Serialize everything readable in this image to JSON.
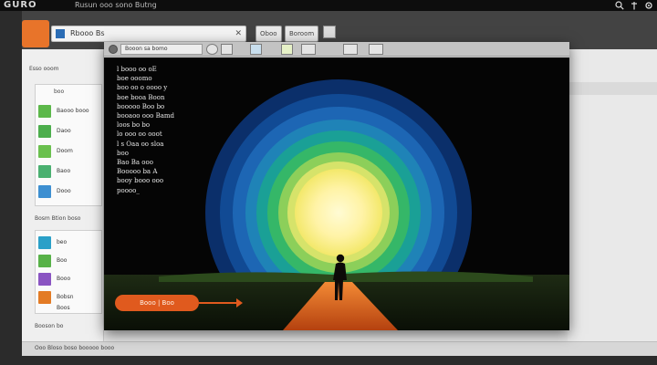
{
  "topbar": {
    "logo": "GURO",
    "title": "Rusun ooo sono Butng",
    "icons": [
      "search-icon",
      "pin-icon",
      "settings-icon"
    ]
  },
  "app": {
    "address_text": "Rbooo Bs",
    "toolbar_buttons": [
      "Oboo",
      "Boroom"
    ],
    "sidebar": {
      "header_top": "Esso ooom",
      "group1_title": "boo",
      "group1_items": [
        "Baooo booo",
        "Daoo",
        "Doom",
        "Baoo",
        "Dooo"
      ],
      "group1_colors": [
        "#5cb84a",
        "#4cae4c",
        "#6ac04e",
        "#4ab070",
        "#3d8fd1"
      ],
      "section2": "Bosm Btion boso",
      "group2_items": [
        "beo",
        "Boo",
        "Booo",
        "Bobsn",
        "Boos"
      ],
      "group2_colors": [
        "#2aa0c8",
        "#58b248",
        "#8a54c2",
        "#e37b25"
      ],
      "section3": "Booson bo"
    },
    "status_text": "Ooo Bloso boso booooo booo"
  },
  "modal": {
    "field": "Booon sa bomo",
    "toolbar_icons": [
      "globe-icon",
      "image-icon",
      "photo-icon",
      "document-icon",
      "grid-icon",
      "layout-icon",
      "calendar-icon"
    ],
    "poem_lines": [
      "l booo oo oE",
      "boe ooomo",
      "boo oo o oooo y",
      "boe booa Boon",
      "booooo Boo bo",
      "booaoo ooo Bamd",
      "loos bo bo",
      "lo ooo oo ooot",
      "l s Oaa oo sloa",
      "boo",
      "Bao Ba ooo",
      "Booooo ba A",
      "booy booo ooo",
      "poooo_"
    ],
    "cta_label": "Booo | Boo",
    "colors": {
      "ring_outer": "#0d3a7a",
      "ring_mid": "#1f77c9",
      "ring_green": "#3db65a",
      "sun_core": "#fff3a6",
      "path_orange": "#e0651f",
      "cta": "#e05a1e"
    }
  }
}
